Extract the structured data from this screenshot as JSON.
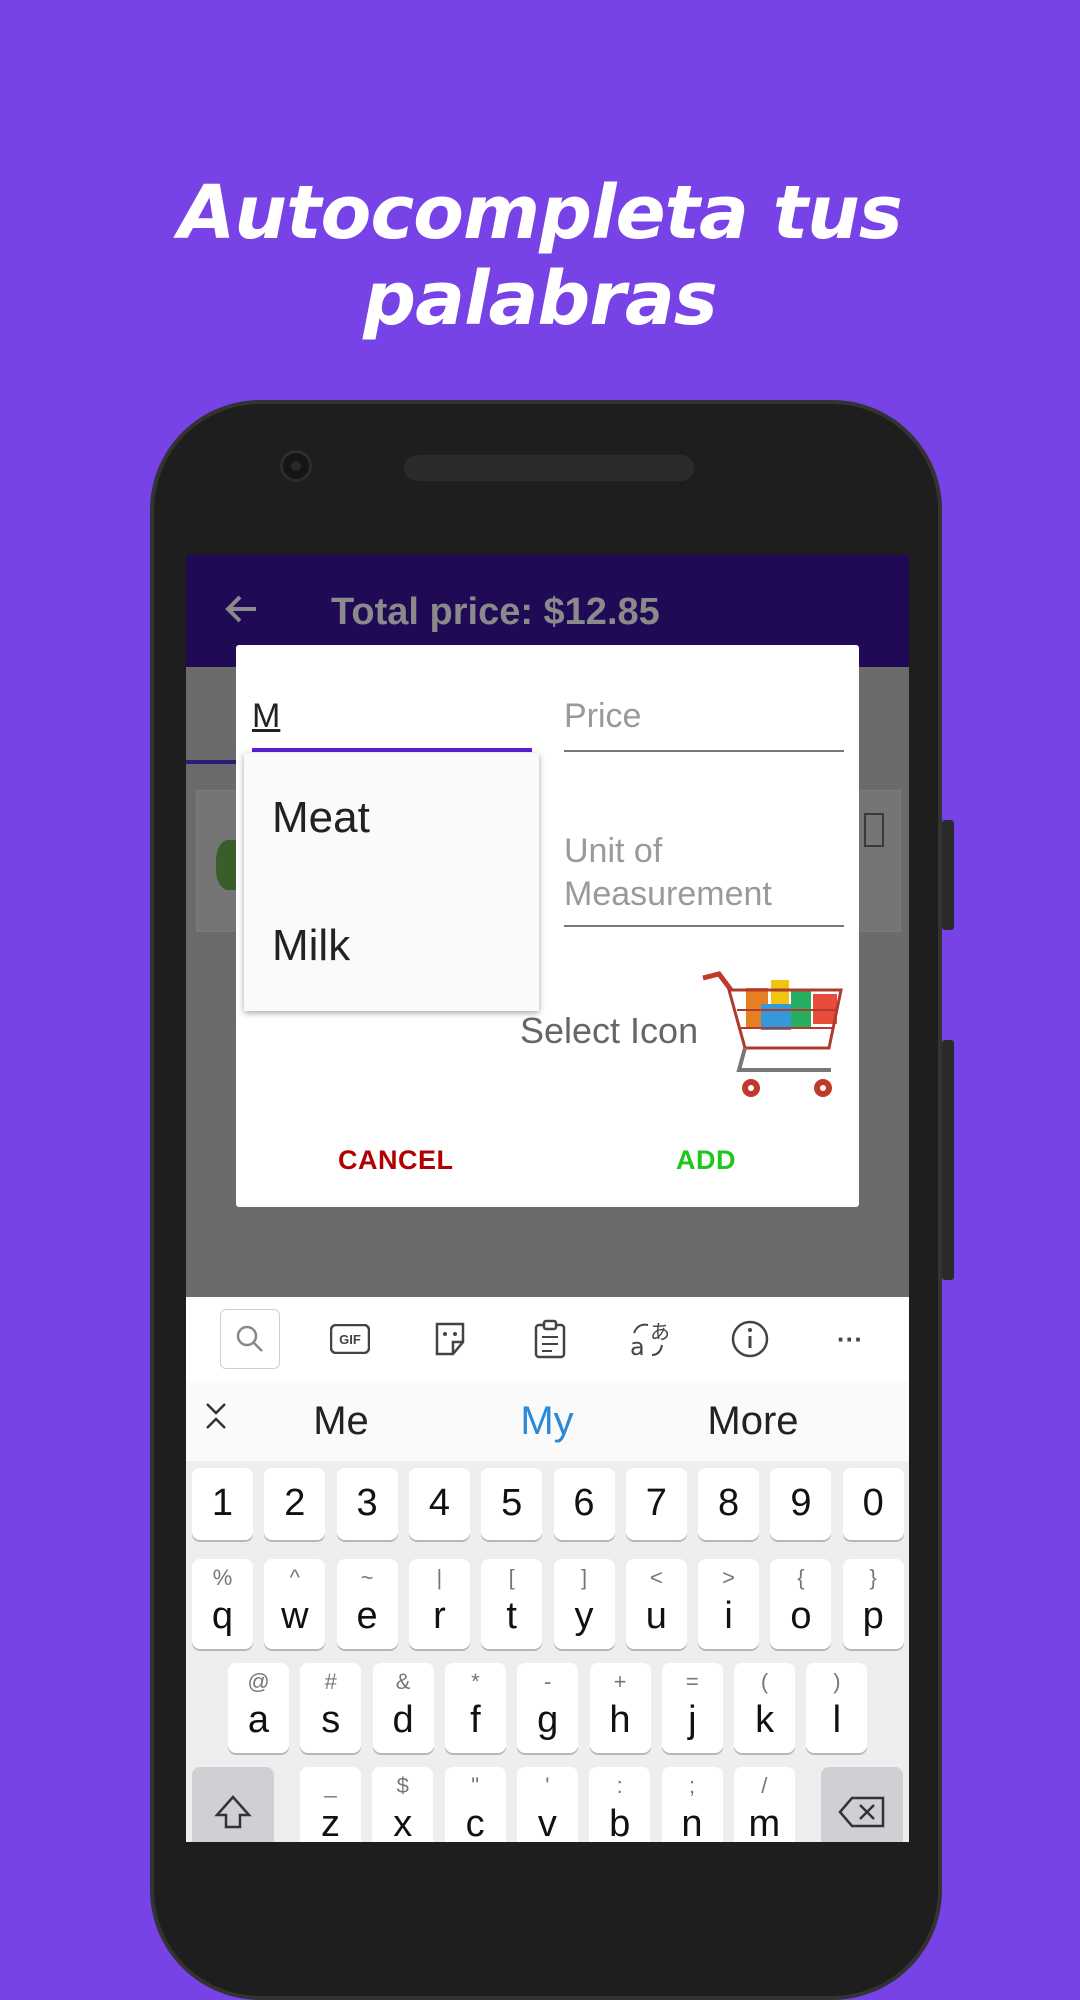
{
  "headline": "Autocompleta tus palabras",
  "app": {
    "title": "Total price: $12.85"
  },
  "dialog": {
    "name_value": "M",
    "price_placeholder": "Price",
    "unit_placeholder": "Unit of Measurement",
    "suggestions": [
      "Meat",
      "Milk"
    ],
    "select_icon_label": "Select Icon",
    "cancel_label": "CANCEL",
    "add_label": "ADD",
    "colors": {
      "cancel": "#b00000",
      "add": "#1bc81b",
      "accent": "#5a1fd4"
    }
  },
  "fab_label": "+",
  "keyboard": {
    "toolbar": [
      "search-icon",
      "gif-icon",
      "sticker-icon",
      "clipboard-icon",
      "translate-icon",
      "info-icon",
      "more-icon"
    ],
    "gif_label": "GIF",
    "more_label": "···",
    "suggestions": [
      "Me",
      "My",
      "More"
    ],
    "number_row": [
      "1",
      "2",
      "3",
      "4",
      "5",
      "6",
      "7",
      "8",
      "9",
      "0"
    ],
    "row1": [
      [
        "q",
        "%"
      ],
      [
        "w",
        "^"
      ],
      [
        "e",
        "~"
      ],
      [
        "r",
        "|"
      ],
      [
        "t",
        "["
      ],
      [
        "y",
        "]"
      ],
      [
        "u",
        "<"
      ],
      [
        "i",
        ">"
      ],
      [
        "o",
        "{"
      ],
      [
        "p",
        "}"
      ]
    ],
    "row2": [
      [
        "a",
        "@"
      ],
      [
        "s",
        "#"
      ],
      [
        "d",
        "&"
      ],
      [
        "f",
        "*"
      ],
      [
        "g",
        "-"
      ],
      [
        "h",
        "+"
      ],
      [
        "j",
        "="
      ],
      [
        "k",
        "("
      ],
      [
        "l",
        ")"
      ]
    ],
    "row3": [
      [
        "z",
        "_"
      ],
      [
        "x",
        "$"
      ],
      [
        "c",
        "\""
      ],
      [
        "v",
        "'"
      ],
      [
        "b",
        ":"
      ],
      [
        "n",
        ";"
      ],
      [
        "m",
        "/"
      ]
    ]
  }
}
